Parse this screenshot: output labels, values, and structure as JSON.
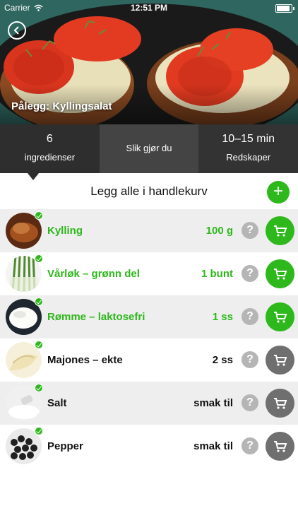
{
  "status_bar": {
    "carrier": "Carrier",
    "time": "12:51 PM"
  },
  "header": {
    "title": "Pålegg: Kyllingsalat"
  },
  "info": {
    "ingredients_count": "6",
    "ingredients_label": "ingredienser",
    "howto_label": "Slik gjør du",
    "time": "10–15 min",
    "tools_label": "Redskaper"
  },
  "add_all": {
    "label": "Legg alle i handlekurv",
    "button": "+"
  },
  "ingredients": [
    {
      "name": "Kylling",
      "qty": "100 g",
      "in_cart": true
    },
    {
      "name": "Vårløk – grønn del",
      "qty": "1 bunt",
      "in_cart": true
    },
    {
      "name": "Rømme – laktosefri",
      "qty": "1 ss",
      "in_cart": true
    },
    {
      "name": "Majones – ekte",
      "qty": "2 ss",
      "in_cart": false
    },
    {
      "name": "Salt",
      "qty": "smak til",
      "in_cart": false
    },
    {
      "name": "Pepper",
      "qty": "smak til",
      "in_cart": false
    }
  ],
  "help_glyph": "?",
  "colors": {
    "accent": "#2db81b",
    "inactive": "#6f6f6f",
    "row_alt": "#eeeeee"
  },
  "icons": [
    "back-icon",
    "wifi-icon",
    "battery-icon",
    "check-icon",
    "cart-icon",
    "plus-icon",
    "help-icon"
  ]
}
